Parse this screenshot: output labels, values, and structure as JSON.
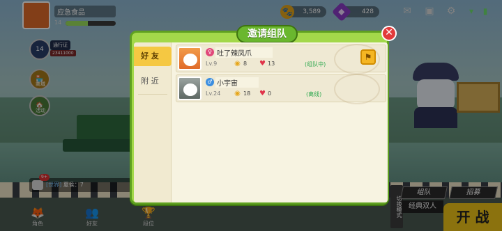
{
  "hud": {
    "player_name": "应急食品",
    "player_level": "14",
    "xp_fraction": 0.45,
    "coins": "3,589",
    "gems": "428"
  },
  "side": {
    "pass_label": "通行证",
    "pass_sub": "23411000",
    "shop_label": "商城",
    "event_label": "活动"
  },
  "chat": {
    "badge": "9+",
    "channel": "[世界]",
    "text": "夏侯：7"
  },
  "nav": {
    "role": "角色",
    "friends": "好友",
    "rank": "段位"
  },
  "bottom_right": {
    "mode_strip": "切换模式",
    "team": "组队",
    "recruit": "招募",
    "mode": "经典双人",
    "start": "开 战"
  },
  "dialog": {
    "title": "邀请组队",
    "tabs": [
      "好 友",
      "附 近"
    ],
    "friends": [
      {
        "gender": "female",
        "name": "吐了辣凤爪",
        "level": "Lv.9",
        "popularity": "8",
        "likes": "13",
        "status": "(组队中)"
      },
      {
        "gender": "male",
        "name": "小宇宙",
        "level": "Lv.24",
        "popularity": "18",
        "likes": "0",
        "status": "(离线)"
      }
    ]
  },
  "colors": {
    "dialog_green": "#a3d84a",
    "tab_active": "#f5c842",
    "status_green": "#2ea84f",
    "close_red": "#e23b3b",
    "start_yellow": "#f0c419"
  }
}
